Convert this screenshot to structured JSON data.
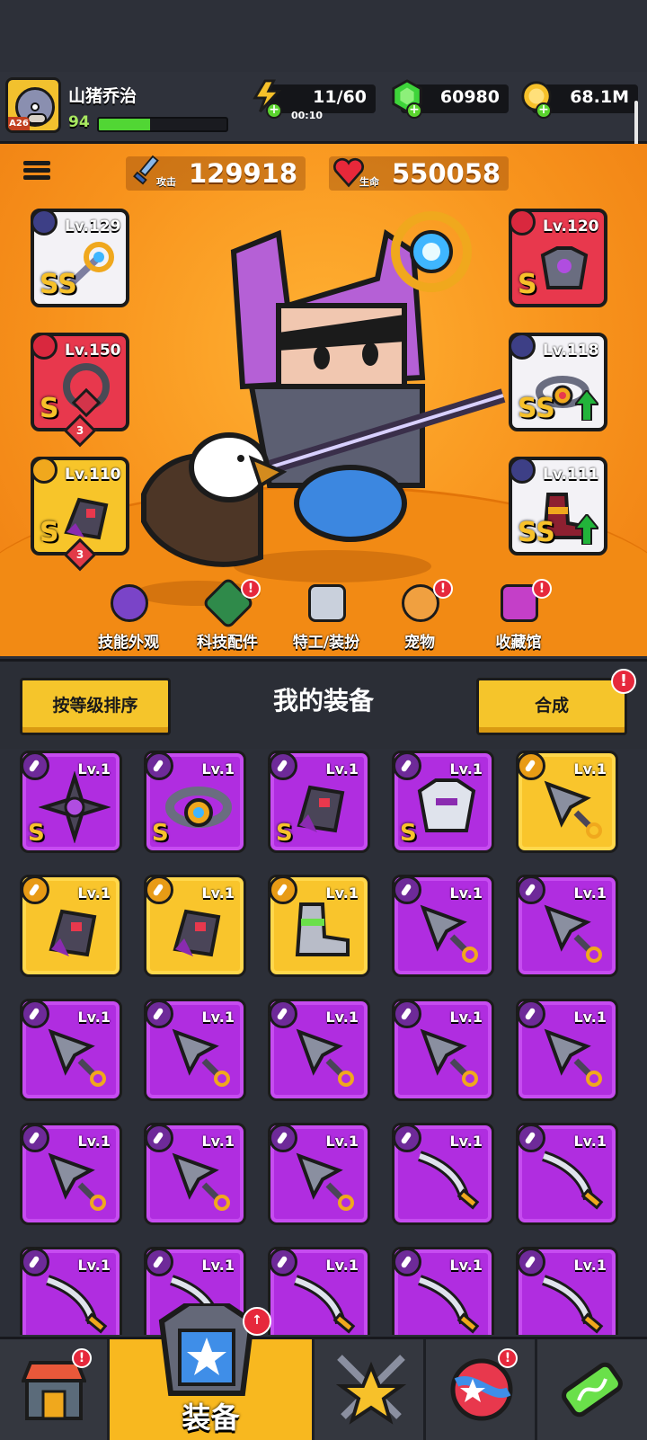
{
  "player": {
    "name": "山猪乔治",
    "level": "94",
    "avatar_tag": "A26",
    "xp_fraction": 0.4
  },
  "resources": {
    "energy": {
      "value": "11/60",
      "timer": "00:10"
    },
    "gems": {
      "value": "60980"
    },
    "coins": {
      "value": "68.1M"
    }
  },
  "stats": {
    "attack": {
      "label": "攻击",
      "value": "129918"
    },
    "hp": {
      "label": "生命",
      "value": "550058"
    }
  },
  "equipped": {
    "left": [
      {
        "level": "Lv.129",
        "rank": "SS",
        "frame": "white"
      },
      {
        "level": "Lv.150",
        "rank": "S",
        "frame": "red",
        "stars": "3"
      },
      {
        "level": "Lv.110",
        "rank": "S",
        "frame": "gold",
        "stars": "3"
      }
    ],
    "right": [
      {
        "level": "Lv.120",
        "rank": "S",
        "frame": "red"
      },
      {
        "level": "Lv.118",
        "rank": "SS",
        "frame": "white"
      },
      {
        "level": "Lv.111",
        "rank": "SS",
        "frame": "white"
      }
    ]
  },
  "feature_nav": [
    {
      "label": "技能外观",
      "alert": false
    },
    {
      "label": "科技配件",
      "alert": true
    },
    {
      "label": "特工/装扮",
      "alert": false
    },
    {
      "label": "宠物",
      "alert": true
    },
    {
      "label": "收藏馆",
      "alert": true
    }
  ],
  "panel": {
    "sort_button": "按等级排序",
    "title": "我的装备",
    "merge_button": "合成",
    "alert": "!"
  },
  "inventory": {
    "rows": [
      [
        {
          "lv": "Lv.1",
          "rank": "S",
          "color": "purple",
          "item": "gear"
        },
        {
          "lv": "Lv.1",
          "rank": "S",
          "color": "purple",
          "item": "belt"
        },
        {
          "lv": "Lv.1",
          "rank": "S",
          "color": "purple",
          "item": "glove"
        },
        {
          "lv": "Lv.1",
          "rank": "S",
          "color": "purple",
          "item": "armor"
        },
        {
          "lv": "Lv.1",
          "rank": "",
          "color": "yellow",
          "item": "kunai"
        }
      ],
      [
        {
          "lv": "Lv.1",
          "rank": "",
          "color": "yellow",
          "item": "glove"
        },
        {
          "lv": "Lv.1",
          "rank": "",
          "color": "yellow",
          "item": "glove"
        },
        {
          "lv": "Lv.1",
          "rank": "",
          "color": "yellow",
          "item": "boot"
        },
        {
          "lv": "Lv.1",
          "rank": "",
          "color": "purple",
          "item": "kunai"
        },
        {
          "lv": "Lv.1",
          "rank": "",
          "color": "purple",
          "item": "kunai"
        }
      ],
      [
        {
          "lv": "Lv.1",
          "rank": "",
          "color": "purple",
          "item": "kunai"
        },
        {
          "lv": "Lv.1",
          "rank": "",
          "color": "purple",
          "item": "kunai"
        },
        {
          "lv": "Lv.1",
          "rank": "",
          "color": "purple",
          "item": "kunai"
        },
        {
          "lv": "Lv.1",
          "rank": "",
          "color": "purple",
          "item": "kunai"
        },
        {
          "lv": "Lv.1",
          "rank": "",
          "color": "purple",
          "item": "kunai"
        }
      ],
      [
        {
          "lv": "Lv.1",
          "rank": "",
          "color": "purple",
          "item": "kunai"
        },
        {
          "lv": "Lv.1",
          "rank": "",
          "color": "purple",
          "item": "kunai"
        },
        {
          "lv": "Lv.1",
          "rank": "",
          "color": "purple",
          "item": "kunai"
        },
        {
          "lv": "Lv.1",
          "rank": "",
          "color": "purple",
          "item": "katana"
        },
        {
          "lv": "Lv.1",
          "rank": "",
          "color": "purple",
          "item": "katana"
        }
      ],
      [
        {
          "lv": "Lv.1",
          "rank": "",
          "color": "purple",
          "item": "katana"
        },
        {
          "lv": "Lv.1",
          "rank": "",
          "color": "purple",
          "item": "katana"
        },
        {
          "lv": "Lv.1",
          "rank": "",
          "color": "purple",
          "item": "katana"
        },
        {
          "lv": "Lv.1",
          "rank": "",
          "color": "purple",
          "item": "katana"
        },
        {
          "lv": "Lv.1",
          "rank": "",
          "color": "purple",
          "item": "katana"
        }
      ]
    ]
  },
  "bottom_tabs": [
    {
      "name": "shop-tab",
      "label": "",
      "alert": true
    },
    {
      "name": "equipment-tab",
      "label": "装备",
      "alert": true,
      "active": true
    },
    {
      "name": "battle-tab",
      "label": "",
      "alert": false
    },
    {
      "name": "world-tab",
      "label": "",
      "alert": true
    },
    {
      "name": "dna-tab",
      "label": "",
      "alert": false
    }
  ],
  "colors": {
    "purple": "#b02de0",
    "yellow": "#f9c52c",
    "orange_bg": "#f8941d",
    "topbar": "#2f323b"
  }
}
